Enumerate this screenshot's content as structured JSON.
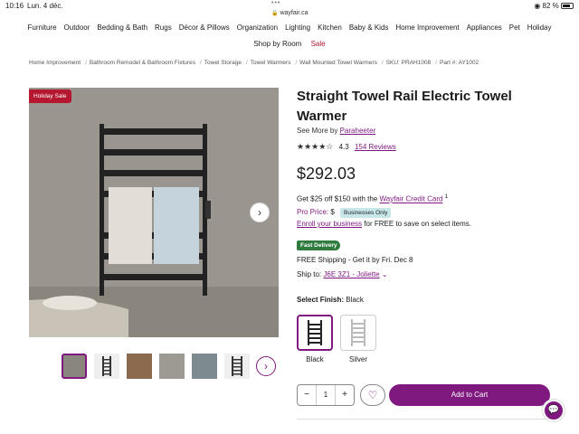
{
  "statusbar": {
    "time": "10:16",
    "date": "Lun. 4 déc.",
    "dots": "•••",
    "url": "wayfair.ca",
    "battery": "82 %",
    "battery_level": 0.82
  },
  "nav": {
    "row1": [
      "Furniture",
      "Outdoor",
      "Bedding & Bath",
      "Rugs",
      "Décor & Pillows",
      "Organization",
      "Lighting",
      "Kitchen",
      "Baby & Kids",
      "Home Improvement",
      "Appliances",
      "Pet",
      "Holiday"
    ],
    "shop_by_room": "Shop by Room",
    "sale": "Sale"
  },
  "breadcrumbs": [
    "Home Improvement",
    "Bathroom Remodel & Bathroom Fixtures",
    "Towel Storage",
    "Towel Warmers",
    "Wall Mounted Towel Warmers",
    "SKU: PRAH1008",
    "Part #: AY1002"
  ],
  "gallery": {
    "badge": "Holiday Sale",
    "next_icon": "chevron-right-icon"
  },
  "product": {
    "title": "Straight Towel Rail Electric Towel Warmer",
    "see_more_prefix": "See More by",
    "brand": "Paraheeter",
    "rating": "4.3",
    "reviews": "154 Reviews",
    "price": "$292.03",
    "credit_text": "Get $25 off $150 with the",
    "credit_link": "Wayfair Credit Card",
    "credit_sup": "1",
    "pro_label": "Pro Price:",
    "pro_value": "$",
    "pro_badge": "Businesses Only",
    "enroll_link": "Enroll your business",
    "enroll_text": "for FREE to save on select items.",
    "fast_delivery": "Fast Delivery",
    "shipping": "FREE Shipping - Get it by Fri. Dec 8",
    "ship_to_label": "Ship to:",
    "ship_to_value": "J6E 3Z1 - Joliette",
    "select_finish_label": "Select Finish:",
    "select_finish_value": "Black",
    "finishes": [
      "Black",
      "Silver"
    ],
    "qty": "1",
    "add_to_cart": "Add to Cart"
  },
  "colors": {
    "accent": "#7f187f",
    "sale": "#b4172f",
    "fast_delivery": "#2f7b3e",
    "business_badge": "#c7e7e9"
  }
}
